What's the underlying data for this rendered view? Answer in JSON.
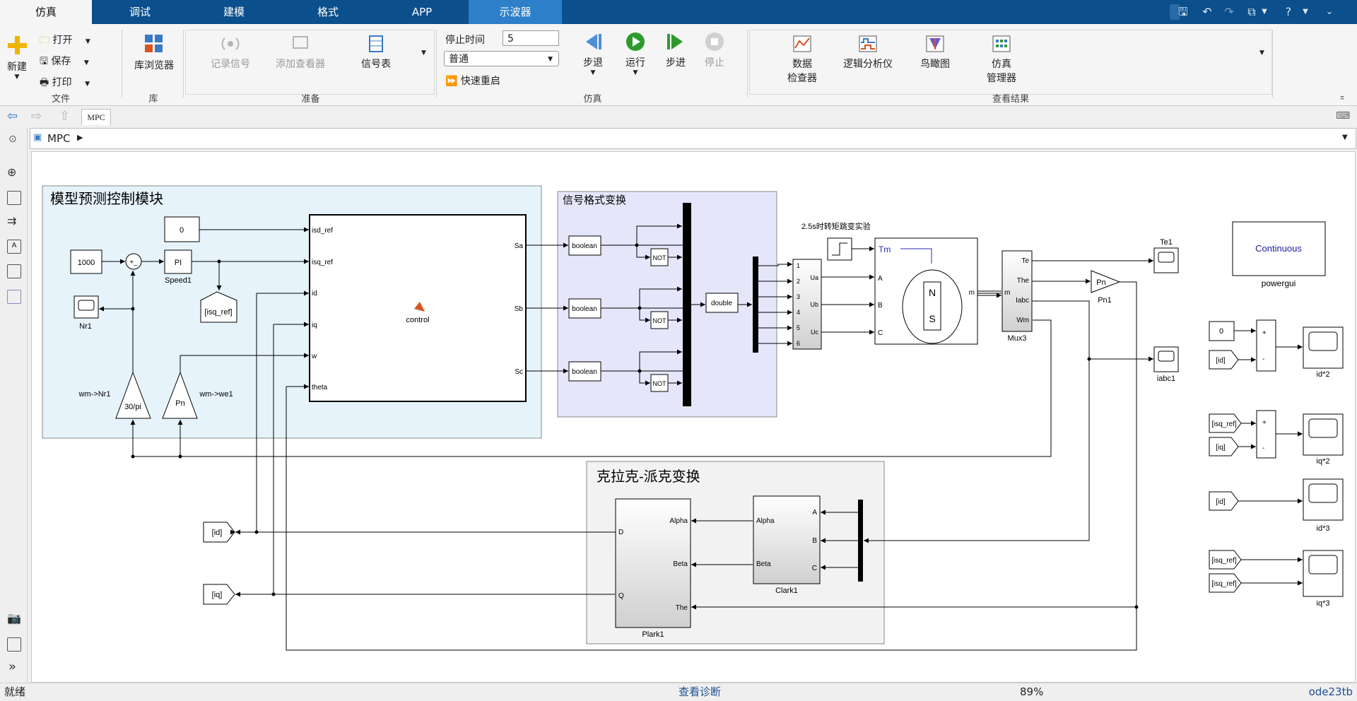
{
  "tabs": [
    "仿真",
    "调试",
    "建模",
    "格式",
    "APP",
    "示波器"
  ],
  "ribbon": {
    "file": {
      "new": "新建",
      "open": "打开",
      "save": "保存",
      "print": "打印",
      "label": "文件"
    },
    "lib": {
      "browser": "库浏览器",
      "label": "库"
    },
    "prep": {
      "record": "记录信号",
      "add_viewer": "添加查看器",
      "signal_table": "信号表",
      "label": "准备"
    },
    "sim": {
      "stop_time_label": "停止时间",
      "stop_time_value": "5",
      "mode": "普通",
      "fast_restart": "快速重启",
      "step_back": "步退",
      "run": "运行",
      "step_fwd": "步进",
      "stop": "停止",
      "label": "仿真"
    },
    "results": {
      "data_inspector_1": "数据",
      "data_inspector_2": "检查器",
      "logic": "逻辑分析仪",
      "birdseye": "鸟瞰图",
      "simmgr_1": "仿真",
      "simmgr_2": "管理器",
      "label": "查看结果"
    }
  },
  "address": {
    "tab": "MPC",
    "breadcrumb": "MPC"
  },
  "status": {
    "left": "就绪",
    "center": "查看诊断",
    "zoom": "89%",
    "solver": "ode23tb"
  },
  "model": {
    "area_mpc": "模型预测控制模块",
    "area_sig": "信号格式变换",
    "area_clark": "克拉克-派克变换",
    "torque_note": "2.5s时转矩跳变实验",
    "const_1000": "1000",
    "const_0a": "0",
    "sum_sign": "+_",
    "pi": "PI",
    "speed1": "Speed1",
    "isq_ref_goto": "[isq_ref]",
    "nr1": "Nr1",
    "gain_30pi": "30/pi",
    "gain_pn": "Pn",
    "wm_nr1": "wm->Nr1",
    "wm_we1": "wm->we1",
    "ctrl_in": [
      "isd_ref",
      "isq_ref",
      "id",
      "iq",
      "w",
      "theta"
    ],
    "ctrl_out": [
      "Sa",
      "Sb",
      "Sc"
    ],
    "ctrl_name": "control",
    "boolean": "boolean",
    "not": "NOT",
    "double": "double",
    "inv_in": [
      "1",
      "2",
      "3",
      "4",
      "5",
      "6"
    ],
    "inv_out": [
      "Ua",
      "Ub",
      "Uc"
    ],
    "motor_tm": "Tm",
    "motor_in": [
      "A",
      "B",
      "C"
    ],
    "motor_m": "m",
    "motor_n": "N",
    "motor_s": "S",
    "mux_out": [
      "Te",
      "The",
      "Iabc",
      "Wm"
    ],
    "mux_in": "m",
    "mux3": "Mux3",
    "te1": "Te1",
    "iabc1": "iabc1",
    "pn1_gain": "Pn",
    "pn1": "Pn1",
    "powergui_text": "Continuous",
    "powergui": "powergui",
    "right_const": "0",
    "right_id": "[id]",
    "right_isq_ref": "[isq_ref]",
    "right_iq": "[iq]",
    "plus": "+",
    "minus": "-",
    "scopes": [
      "id*2",
      "iq*2",
      "id*3",
      "iq*3"
    ],
    "park_in": [
      "D",
      "Q"
    ],
    "park_out": [
      "Alpha",
      "Beta",
      "The"
    ],
    "park_name": "Plark1",
    "clark_out": [
      "Alpha",
      "Beta"
    ],
    "clark_in": [
      "A",
      "B",
      "C"
    ],
    "clark_name": "Clark1",
    "goto_id": "[id]",
    "goto_iq": "[iq]"
  }
}
